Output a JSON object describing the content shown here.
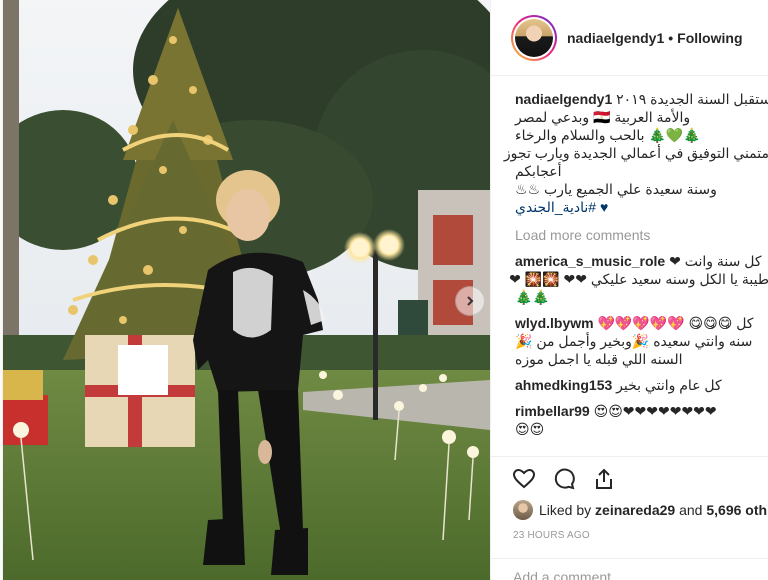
{
  "post": {
    "username": "nadiaelgendy1",
    "separator": "•",
    "follow_status": "Following"
  },
  "caption": {
    "username": "nadiaelgendy1",
    "lines": [
      "بستقبل السنة الجديدة ٢٠١٩",
      "والأمة العربية 🇪🇬 وبدعي لمصر",
      "🎄💚🎄 بالحب والسلام والرخاء",
      "متمني التوفيق في أعمالي الجديدة ويارب تجوز",
      "أعجابكم",
      "وسنة سعيدة علي الجميع يارب ♨♨",
      "♥ #نادية_الجندي"
    ]
  },
  "load_more_label": "Load more comments",
  "comments": [
    {
      "username": "america_s_music_role",
      "lines": [
        "كل سنة وانت ❤",
        "طيبة يا الكل وسنه سعيد عليكي ❤❤ 🎇🎇 ❤",
        "🎄🎄"
      ]
    },
    {
      "username": "wlyd.lbywm",
      "lines": [
        "كل 😋😋😋 💖💖💖💖💖",
        "سنه وانتي سعيده 🎉وبخير وأجمل من 🎉",
        "السنه اللي قبله يا اجمل موزه"
      ]
    },
    {
      "username": "ahmedking153",
      "lines": [
        "كل عام وانتي بخير"
      ]
    },
    {
      "username": "rimbellar99",
      "lines": [
        "😍😍❤❤❤❤❤❤❤❤",
        "😍😍"
      ]
    }
  ],
  "actions": {
    "like_icon": "heart-icon",
    "comment_icon": "comment-icon",
    "share_icon": "share-icon"
  },
  "likes": {
    "prefix": "Liked by",
    "user": "zeinareda29",
    "and": "and",
    "others": "5,696 oth"
  },
  "time_ago": "23 HOURS AGO",
  "add_comment_placeholder": "Add a comment…",
  "colors": {
    "text": "#262626",
    "muted": "#999999",
    "hashtag": "#003569",
    "border": "#efefef"
  }
}
